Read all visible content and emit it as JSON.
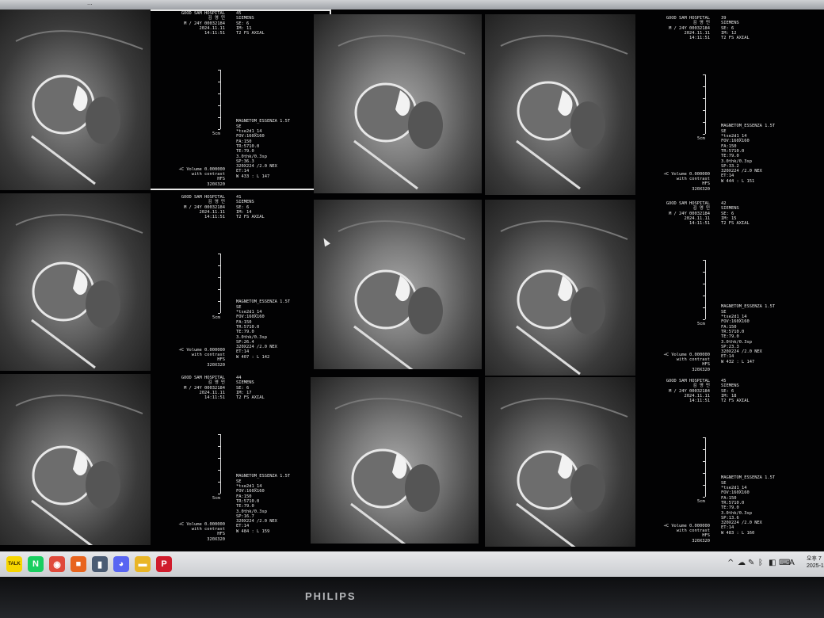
{
  "screen": {
    "topbar_label": "...",
    "viewports": [
      {
        "image": "45",
        "hospital": "GOOD SAM  HOSPITAL",
        "patient_name": "김 영 민",
        "patient_id": "M / 24Y 00032184",
        "date": "2024.11.11",
        "time": "14:11:51",
        "vendor": "SIEMENS",
        "series": "SE: 6",
        "image_num": "IM: 11",
        "sequence": "T2 FS AXIAL",
        "scale": "5cm",
        "scanner": "MAGNETOM_ESSENZA 1.5T",
        "mode": "SE",
        "pulse": "*tse2d1_14",
        "fov": "FOV:160X160",
        "fa": "FA:150",
        "tr": "TR:5710.0",
        "te": "TE:79.0",
        "thickness": "3.0thk/0.3sp",
        "sp": "SP:36.3",
        "matrix": "320X224 /2.0 NEX",
        "et": "ET:14",
        "contrast": "+C Volume 0.000000",
        "contrast2": "with contrast",
        "orient": "HFS",
        "size": "320X320",
        "window": "W 433 : L 147"
      },
      {
        "image": "39",
        "hospital": "GOOD SAM  HOSPITAL",
        "patient_name": "김 영 민",
        "patient_id": "M / 24Y 00032184",
        "date": "2024.11.11",
        "time": "14:11:51",
        "vendor": "SIEMENS",
        "series": "SE: 6",
        "image_num": "IM: 12",
        "sequence": "T2 FS AXIAL",
        "scale": "5cm",
        "scanner": "MAGNETOM_ESSENZA 1.5T",
        "mode": "SE",
        "pulse": "*tse2d1_14",
        "fov": "FOV:160X160",
        "fa": "FA:150",
        "tr": "TR:5710.0",
        "te": "TE:79.0",
        "thickness": "3.0thk/0.3sp",
        "sp": "SP:33.2",
        "matrix": "320X224 /2.0 NEX",
        "et": "ET:14",
        "contrast": "+C Volume 0.000000",
        "contrast2": "with contrast",
        "orient": "HFS",
        "size": "320X320",
        "window": "W 444 : L 151"
      },
      {
        "image": "41",
        "hospital": "GOOD SAM  HOSPITAL",
        "patient_name": "김 영 민",
        "patient_id": "M / 24Y 00032184",
        "date": "2024.11.11",
        "time": "14:11:51",
        "vendor": "SIEMENS",
        "series": "SE: 6",
        "image_num": "IM: 14",
        "sequence": "T2 FS AXIAL",
        "scale": "5cm",
        "scanner": "MAGNETOM_ESSENZA 1.5T",
        "mode": "SE",
        "pulse": "*tse2d1_14",
        "fov": "FOV:160X160",
        "fa": "FA:150",
        "tr": "TR:5710.0",
        "te": "TE:79.0",
        "thickness": "3.0thk/0.3sp",
        "sp": "SP:26.4",
        "matrix": "320X224 /2.0 NEX",
        "et": "ET:14",
        "contrast": "+C Volume 0.000000",
        "contrast2": "with contrast",
        "orient": "HFS",
        "size": "320X320",
        "window": "W 407 : L 142"
      },
      {
        "image": "42",
        "hospital": "GOOD SAM  HOSPITAL",
        "patient_name": "김 영 민",
        "patient_id": "M / 24Y 00032184",
        "date": "2024.11.11",
        "time": "14:11:51",
        "vendor": "SIEMENS",
        "series": "SE: 6",
        "image_num": "IM: 15",
        "sequence": "T2 FS AXIAL",
        "scale": "5cm",
        "scanner": "MAGNETOM_ESSENZA 1.5T",
        "mode": "SE",
        "pulse": "*tse2d1_14",
        "fov": "FOV:160X160",
        "fa": "FA:150",
        "tr": "TR:5710.0",
        "te": "TE:79.0",
        "thickness": "3.0thk/0.3sp",
        "sp": "SP:23.3",
        "matrix": "320X224 /2.0 NEX",
        "et": "ET:14",
        "contrast": "+C Volume 0.000000",
        "contrast2": "with contrast",
        "orient": "HFS",
        "size": "320X320",
        "window": "W 432 : L 147"
      },
      {
        "image": "44",
        "hospital": "GOOD SAM  HOSPITAL",
        "patient_name": "김 영 민",
        "patient_id": "M / 24Y 00032184",
        "date": "2024.11.11",
        "time": "14:11:51",
        "vendor": "SIEMENS",
        "series": "SE: 6",
        "image_num": "IM: 17",
        "sequence": "T2 FS AXIAL",
        "scale": "5cm",
        "scanner": "MAGNETOM_ESSENZA 1.5T",
        "mode": "SE",
        "pulse": "*tse2d1_14",
        "fov": "FOV:160X160",
        "fa": "FA:150",
        "tr": "TR:5710.0",
        "te": "TE:79.0",
        "thickness": "3.0thk/0.3sp",
        "sp": "SP:16.7",
        "matrix": "320X224 /2.0 NEX",
        "et": "ET:14",
        "contrast": "+C Volume 0.000000",
        "contrast2": "with contrast",
        "orient": "HFS",
        "size": "320X320",
        "window": "W 484 : L 159"
      },
      {
        "image": "45",
        "hospital": "GOOD SAM  HOSPITAL",
        "patient_name": "김 영 민",
        "patient_id": "M / 24Y 00032184",
        "date": "2024.11.11",
        "time": "14:11:51",
        "vendor": "SIEMENS",
        "series": "SE: 6",
        "image_num": "IM: 18",
        "sequence": "T2 FS AXIAL",
        "scale": "5cm",
        "scanner": "MAGNETOM_ESSENZA 1.5T",
        "mode": "SE",
        "pulse": "*tse2d1_14",
        "fov": "FOV:160X160",
        "fa": "FA:150",
        "tr": "TR:5710.0",
        "te": "TE:79.0",
        "thickness": "3.0thk/0.3sp",
        "sp": "SP:13.6",
        "matrix": "320X224 /2.0 NEX",
        "et": "ET:14",
        "contrast": "+C Volume 0.000000",
        "contrast2": "with contrast",
        "orient": "HFS",
        "size": "320X320",
        "window": "W 483 : L 160"
      }
    ]
  },
  "taskbar": {
    "apps": [
      {
        "name": "kakaotalk",
        "glyph": "TALK",
        "color": "#f7d600"
      },
      {
        "name": "naver",
        "glyph": "N",
        "color": "#19ce60"
      },
      {
        "name": "chrome",
        "glyph": "◉",
        "color": "#e04a3b"
      },
      {
        "name": "app-orange",
        "glyph": "■",
        "color": "#e8641e"
      },
      {
        "name": "app-terminal",
        "glyph": "▮",
        "color": "#4a5b73"
      },
      {
        "name": "discord",
        "glyph": "◕",
        "color": "#5865f2"
      },
      {
        "name": "file-explorer",
        "glyph": "▬",
        "color": "#e9b526"
      },
      {
        "name": "app-red",
        "glyph": "P",
        "color": "#d01c2c"
      }
    ],
    "tray": [
      "^",
      "☁",
      "✎",
      "ᛒ",
      "◧",
      "⌨",
      "A"
    ],
    "clock_time": "오후 7",
    "clock_date": "2025-1"
  },
  "monitor": {
    "brand": "PHILIPS"
  }
}
